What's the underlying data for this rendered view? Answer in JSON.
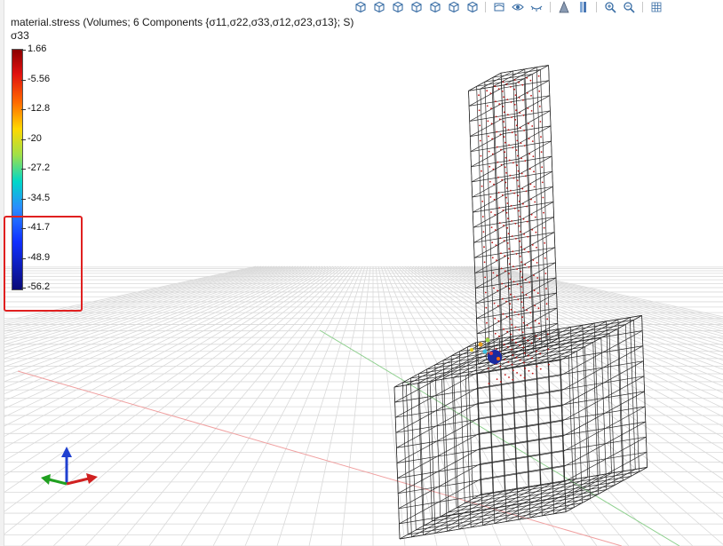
{
  "field": {
    "title": "material.stress (Volumes; 6 Components {σ11,σ22,σ33,σ12,σ23,σ13}; S)",
    "component": "σ33"
  },
  "colorbar": {
    "ticks": [
      "1.66",
      "-5.56",
      "-12.8",
      "-20",
      "-27.2",
      "-34.5",
      "-41.7",
      "-48.9",
      "-56.2"
    ]
  },
  "toolbar": {
    "icons": [
      "iso-view-icon",
      "front-view-icon",
      "back-view-icon",
      "left-view-icon",
      "right-view-icon",
      "top-view-icon",
      "bottom-view-icon",
      "show-hide-icon",
      "eye-icon",
      "eye-closed-icon",
      "perspective-icon",
      "orthographic-icon",
      "zoom-in-icon",
      "zoom-out-icon",
      "grid-icon"
    ]
  },
  "colors": {
    "highlight": "#e02020",
    "axis_x": "#d02020",
    "axis_y": "#20a020",
    "axis_z": "#2040d0",
    "mesh": "#2a2a2a",
    "points": "#c01818"
  }
}
